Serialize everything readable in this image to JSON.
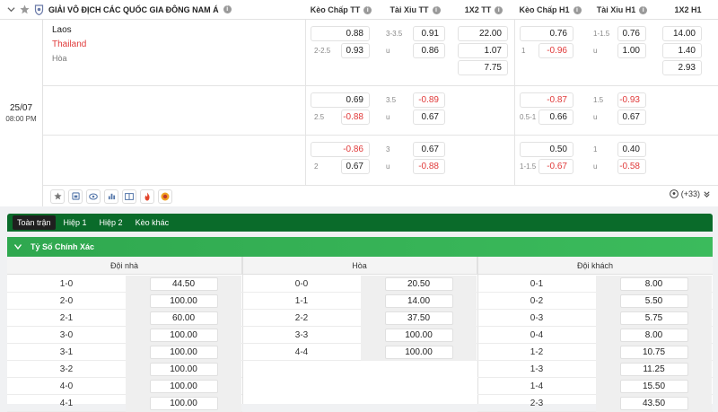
{
  "league": {
    "name": "GIẢI VÔ ĐỊCH CÁC QUỐC GIA ĐÔNG NAM Á"
  },
  "columns": [
    "Kèo Chấp TT",
    "Tài Xỉu TT",
    "1X2 TT",
    "Kèo Chấp H1",
    "Tài Xỉu H1",
    "1X2 H1"
  ],
  "match": {
    "date": "25/07",
    "time": "08:00 PM",
    "home": "Laos",
    "away": "Thailand",
    "draw": "Hòa"
  },
  "odds": {
    "r1": {
      "hc_tt": {
        "line": "2-2.5",
        "a": "0.88",
        "b": "0.93"
      },
      "ou_tt": {
        "line": "3-3.5",
        "u": "u",
        "a": "0.91",
        "b": "0.86"
      },
      "x12_tt": [
        "22.00",
        "1.07",
        "7.75"
      ],
      "hc_h1": {
        "line": "1",
        "a": "0.76",
        "b": "-0.96"
      },
      "ou_h1": {
        "line": "1-1.5",
        "u": "u",
        "a": "0.76",
        "b": "1.00"
      },
      "x12_h1": [
        "14.00",
        "1.40",
        "2.93"
      ]
    },
    "r2": {
      "hc_tt": {
        "line": "2.5",
        "a": "0.69",
        "b": "-0.88"
      },
      "ou_tt": {
        "line": "3.5",
        "u": "u",
        "a": "-0.89",
        "b": "0.67"
      },
      "hc_h1": {
        "line": "0.5-1",
        "a": "-0.87",
        "b": "0.66"
      },
      "ou_h1": {
        "line": "1.5",
        "u": "u",
        "a": "-0.93",
        "b": "0.67"
      }
    },
    "r3": {
      "hc_tt": {
        "line": "2",
        "a": "-0.86",
        "b": "0.67"
      },
      "ou_tt": {
        "line": "3",
        "u": "u",
        "a": "0.67",
        "b": "-0.88"
      },
      "hc_h1": {
        "line": "1-1.5",
        "a": "0.50",
        "b": "-0.67"
      },
      "ou_h1": {
        "line": "1",
        "u": "u",
        "a": "0.40",
        "b": "-0.58"
      }
    }
  },
  "more": "(+33)",
  "tabs": [
    "Toàn trận",
    "Hiệp 1",
    "Hiệp 2",
    "Kèo khác"
  ],
  "section": {
    "title": "Tỷ Số Chính Xác"
  },
  "cs": {
    "heads": [
      "Đội nhà",
      "Hòa",
      "Đội khách"
    ],
    "home": [
      [
        "1-0",
        "44.50"
      ],
      [
        "2-0",
        "100.00"
      ],
      [
        "2-1",
        "60.00"
      ],
      [
        "3-0",
        "100.00"
      ],
      [
        "3-1",
        "100.00"
      ],
      [
        "3-2",
        "100.00"
      ],
      [
        "4-0",
        "100.00"
      ],
      [
        "4-1",
        "100.00"
      ]
    ],
    "draw": [
      [
        "0-0",
        "20.50"
      ],
      [
        "1-1",
        "14.00"
      ],
      [
        "2-2",
        "37.50"
      ],
      [
        "3-3",
        "100.00"
      ],
      [
        "4-4",
        "100.00"
      ]
    ],
    "away": [
      [
        "0-1",
        "8.00"
      ],
      [
        "0-2",
        "5.50"
      ],
      [
        "0-3",
        "5.75"
      ],
      [
        "0-4",
        "8.00"
      ],
      [
        "1-2",
        "10.75"
      ],
      [
        "1-3",
        "11.25"
      ],
      [
        "1-4",
        "15.50"
      ],
      [
        "2-3",
        "43.50"
      ]
    ]
  },
  "colors": {
    "accent": "#0a6b2a",
    "section": "#37b457",
    "negative": "#e03a3a"
  }
}
